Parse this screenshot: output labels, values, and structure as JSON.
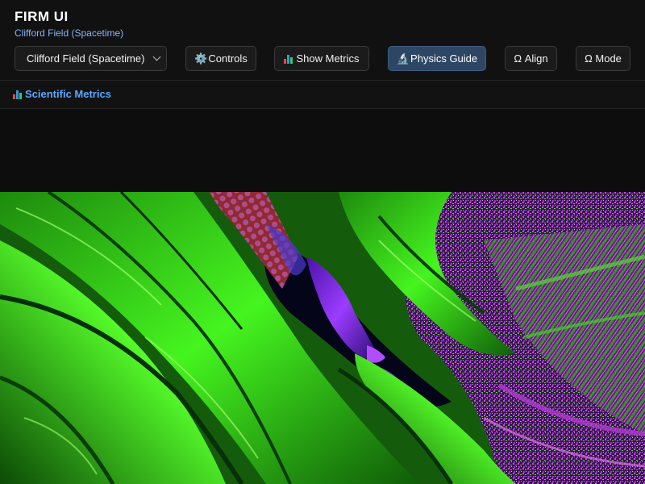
{
  "app": {
    "title": "FIRM UI",
    "subtitle": "Clifford Field (Spacetime)"
  },
  "toolbar": {
    "field_select": {
      "selected": "Clifford Field (Spacetime)"
    },
    "controls_label": "Controls",
    "controls_icon": "gear-icon",
    "show_metrics_label": "Show Metrics",
    "show_metrics_icon": "bar-chart-icon",
    "physics_guide_label": "Physics Guide",
    "physics_guide_icon": "microscope-icon",
    "align_label": "Ω Align",
    "mode_label": "Ω Mode"
  },
  "metrics_panel": {
    "label": "Scientific Metrics",
    "icon": "bar-chart-icon"
  },
  "colors": {
    "accent_blue": "#5aa7ff",
    "active_button": "#2d4663",
    "field_green": "#3ee51c",
    "field_purple": "#7a2be0",
    "field_magenta": "#c23bd4"
  }
}
